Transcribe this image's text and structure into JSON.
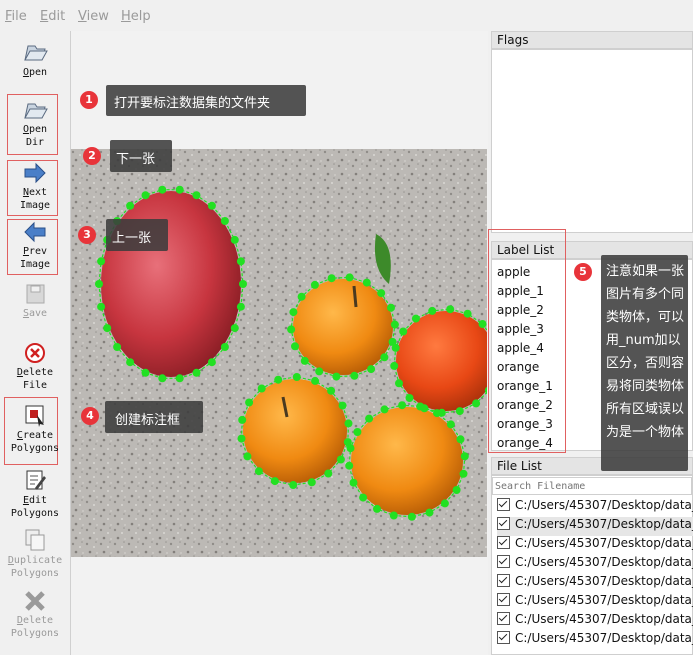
{
  "menu": [
    "File",
    "Edit",
    "View",
    "Help"
  ],
  "tools": [
    {
      "label": "Open",
      "icon": "folder-open-icon",
      "enabled": true
    },
    {
      "label": "Open\nDir",
      "icon": "folder-open-icon",
      "enabled": true
    },
    {
      "label": "Next\nImage",
      "icon": "arrow-right-icon",
      "enabled": true
    },
    {
      "label": "Prev\nImage",
      "icon": "arrow-left-icon",
      "enabled": true
    },
    {
      "label": "Save",
      "icon": "floppy-icon",
      "enabled": false
    },
    {
      "label": "Delete\nFile",
      "icon": "delete-circle-icon",
      "enabled": true
    },
    {
      "label": "Create\nPolygons",
      "icon": "polygon-create-icon",
      "enabled": true
    },
    {
      "label": "Edit\nPolygons",
      "icon": "edit-pencil-icon",
      "enabled": true
    },
    {
      "label": "Duplicate\nPolygons",
      "icon": "duplicate-icon",
      "enabled": false
    },
    {
      "label": "Delete\nPolygons",
      "icon": "delete-x-icon",
      "enabled": false
    }
  ],
  "panels": {
    "flags_title": "Flags",
    "label_list_title": "Label List",
    "file_list_title": "File List",
    "search_placeholder": "Search Filename"
  },
  "labels": [
    "apple",
    "apple_1",
    "apple_2",
    "apple_3",
    "apple_4",
    "orange",
    "orange_1",
    "orange_2",
    "orange_3",
    "orange_4"
  ],
  "files": [
    "C:/Users/45307/Desktop/data_",
    "C:/Users/45307/Desktop/data_",
    "C:/Users/45307/Desktop/data_",
    "C:/Users/45307/Desktop/data_",
    "C:/Users/45307/Desktop/data_",
    "C:/Users/45307/Desktop/data_",
    "C:/Users/45307/Desktop/data_",
    "C:/Users/45307/Desktop/data_"
  ],
  "callouts": [
    {
      "num": "1",
      "text": "打开要标注数据集的文件夹"
    },
    {
      "num": "2",
      "text": "下一张"
    },
    {
      "num": "3",
      "text": "上一张"
    },
    {
      "num": "4",
      "text": "创建标注框"
    },
    {
      "num": "5",
      "text": "注意如果一张图片有多个同类物体，可以用_num加以区分，否则容易将同类物体所有区域误以为是一个物体"
    }
  ],
  "colors": {
    "polygon": "#22e022",
    "badge": "#e8343a",
    "callout_bg": "#3c3c3c",
    "highlight_box": "#e06060"
  }
}
